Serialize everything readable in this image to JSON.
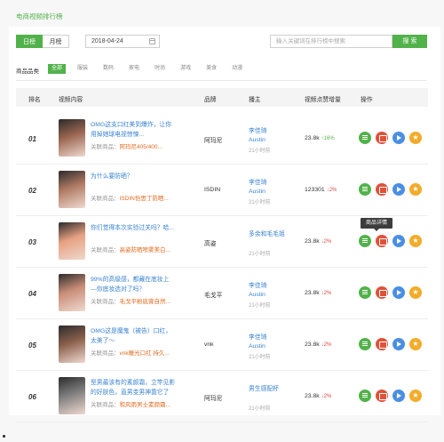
{
  "page_title": "电商视频排行榜",
  "toolbar": {
    "tab_day": "日榜",
    "tab_month": "月榜",
    "date_value": "2018-04-24",
    "search_placeholder": "输入关键词在排行榜中搜索",
    "search_button": "搜 索"
  },
  "categories": {
    "label": "商品品类",
    "items": [
      "全部",
      "服装",
      "数码",
      "家电",
      "时尚",
      "游戏",
      "美食",
      "动漫"
    ],
    "active": "全部"
  },
  "table": {
    "headers": {
      "rank": "排名",
      "video": "视频内容",
      "brand": "品牌",
      "host": "播主",
      "likes": "视频点赞增量",
      "ops": "操作"
    },
    "product_prefix": "关联商品：",
    "rows": [
      {
        "rank": "01",
        "title_line1": "OMG这支口红美到爆炸，让你",
        "title_line2": "用掉她球电视惊悚...",
        "product": "阿玛尼405/400...",
        "brand": "阿玛尼",
        "host_line1": "李佳琦",
        "host_line2": "Austin",
        "time": "21小时前",
        "likes": "23.8k",
        "delta": "↑16%",
        "delta_dir": "up",
        "thumb_color": "#9a6650"
      },
      {
        "rank": "02",
        "title_line1": "为什么要防晒？",
        "title_line2": "",
        "product": "ISDIN怡思丁防晒...",
        "brand": "ISDIN",
        "host_line1": "李佳琦",
        "host_line2": "Austin",
        "time": "21小时前",
        "likes": "123301",
        "delta": "↓2%",
        "delta_dir": "down",
        "thumb_color": "#b07a64"
      },
      {
        "rank": "03",
        "title_line1": "你们觉得本次实验过关吗？哈...",
        "title_line2": "",
        "product": "高姿防晒喷雾美白...",
        "brand": "高姿",
        "host_line1": "多余和毛毛姐",
        "host_line2": "",
        "time": "21小时前",
        "likes": "23.8k",
        "delta": "↓2%",
        "delta_dir": "down",
        "thumb_color": "#e7a182"
      },
      {
        "rank": "04",
        "title_line1": "99%的高级感，都藏在底妆上",
        "title_line2": "—你底妆选对了吗？",
        "product": "毛戈平粉底膏自然...",
        "brand": "毛戈平",
        "host_line1": "李佳琦",
        "host_line2": "Austin",
        "time": "21小时前",
        "likes": "23.8k",
        "delta": "↓2%",
        "delta_dir": "down",
        "thumb_color": "#c98e78"
      },
      {
        "rank": "05",
        "title_line1": "OMG这是魔鬼（被告）口红，",
        "title_line2": "太美了～",
        "product": "vnk暖光口红 持久...",
        "brand": "vnk",
        "host_line1": "李佳琦",
        "host_line2": "Austin",
        "time": "21小时前",
        "likes": "23.8k",
        "delta": "↓2%",
        "delta_dir": "down",
        "thumb_color": "#8a5f4c"
      },
      {
        "rank": "06",
        "title_line1": "型男最该有的素颜霜，立竿见影",
        "title_line2": "的好肤色，直男变男神靠它了",
        "product": "和风雨男士素颜霜...",
        "brand": "阿玛尼",
        "host_line1": "男生感配杯",
        "host_line2": "",
        "time": "21小时前",
        "likes": "23.8k",
        "delta": "↓2%",
        "delta_dir": "down",
        "thumb_color": "#7d7d7d"
      }
    ]
  },
  "tooltip": "商品详情",
  "icons": [
    "calendar-icon",
    "detail-icon",
    "shop-icon",
    "play-icon",
    "star-icon"
  ],
  "colors": {
    "accent": "#52b24a",
    "link": "#3a83d1",
    "product": "#e06b1f",
    "up": "#52b24a",
    "down": "#e04444"
  }
}
